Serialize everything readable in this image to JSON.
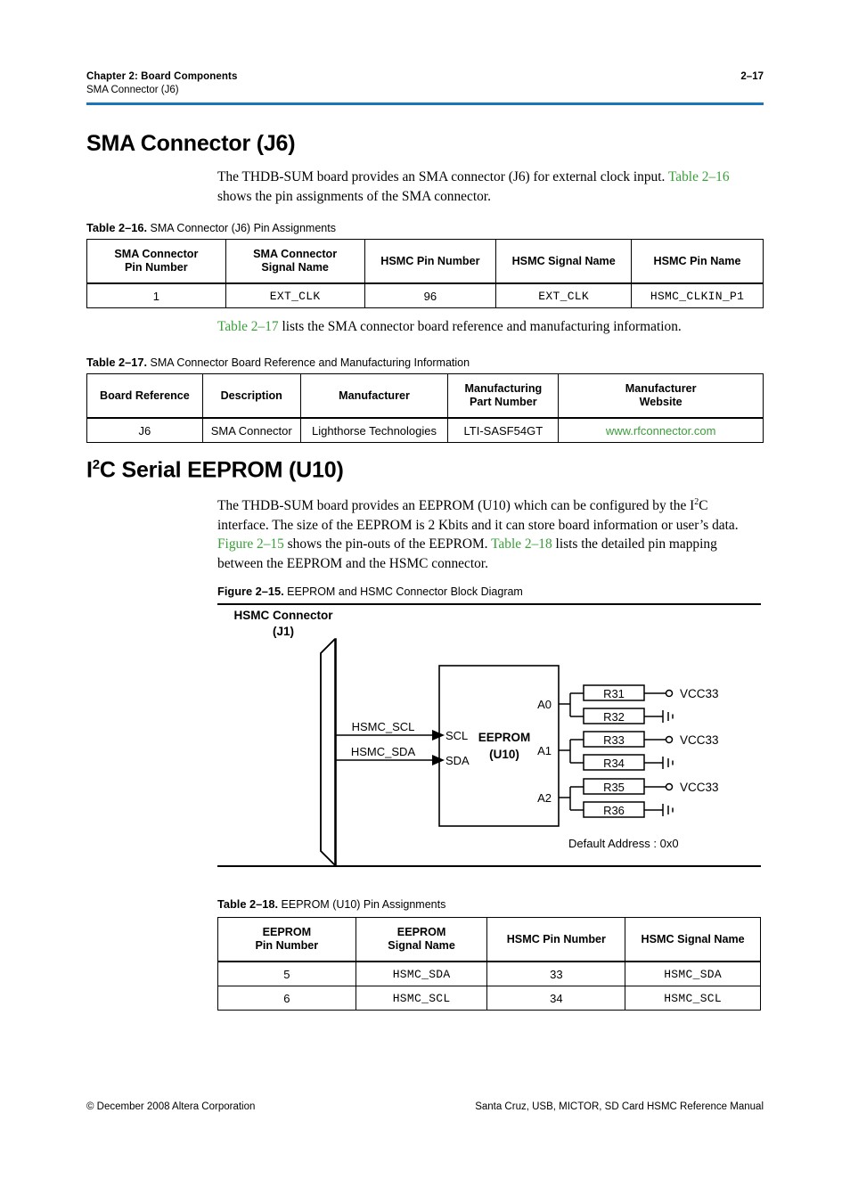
{
  "header": {
    "chapter": "Chapter 2:  Board Components",
    "subtitle": "SMA Connector (J6)",
    "page_number": "2–17",
    "rule_color": "#1b75bb"
  },
  "colors": {
    "link_green": "#3a9e3a",
    "rule_blue": "#1b75bb"
  },
  "sections": {
    "sma": {
      "heading": "SMA Connector (J6)",
      "para1_a": "The THDB-SUM board provides an SMA connector (J6) for external clock input. ",
      "para1_link": "Table 2–16",
      "para1_b": " shows the pin assignments of the SMA connector.",
      "para2_link": "Table 2–17",
      "para2_b": " lists the SMA connector board reference and manufacturing information."
    },
    "eeprom": {
      "heading_pre": "I",
      "heading_sup": "2",
      "heading_post": "C Serial EEPROM (U10)",
      "para_a": "The THDB-SUM board provides an EEPROM (U10) which can be configured by the I",
      "para_sup": "2",
      "para_b": "C interface. The size of the EEPROM is 2 Kbits and it can store board information or user’s data. ",
      "para_link1": "Figure 2–15",
      "para_c": " shows the pin-outs of the EEPROM. ",
      "para_link2": "Table 2–18",
      "para_d": " lists the detailed pin mapping between the EEPROM and the HSMC connector."
    }
  },
  "table_2_16": {
    "caption_label": "Table 2–16.",
    "caption_text": "SMA Connector (J6) Pin Assignments",
    "headers": [
      "SMA Connector\nPin Number",
      "SMA Connector\nSignal Name",
      "HSMC Pin Number",
      "HSMC Signal Name",
      "HSMC Pin Name"
    ],
    "header_lines": [
      [
        "SMA Connector",
        "Pin Number"
      ],
      [
        "SMA Connector",
        "Signal Name"
      ],
      [
        "HSMC Pin Number",
        ""
      ],
      [
        "HSMC Signal Name",
        ""
      ],
      [
        "HSMC Pin Name",
        ""
      ]
    ],
    "rows": [
      [
        "1",
        "EXT_CLK",
        "96",
        "EXT_CLK",
        "HSMC_CLKIN_P1"
      ]
    ]
  },
  "table_2_17": {
    "caption_label": "Table 2–17.",
    "caption_text": "SMA Connector Board Reference and Manufacturing Information",
    "header_lines": [
      [
        "Board Reference",
        ""
      ],
      [
        "Description",
        ""
      ],
      [
        "Manufacturer",
        ""
      ],
      [
        "Manufacturing",
        "Part Number"
      ],
      [
        "Manufacturer",
        "Website"
      ]
    ],
    "rows": [
      [
        "J6",
        "SMA Connector",
        "Lighthorse Technologies",
        "LTI-SASF54GT",
        "www.rfconnector.com"
      ]
    ],
    "website_is_link": true
  },
  "figure_2_15": {
    "caption_label": "Figure 2–15.",
    "caption_text": "EEPROM and HSMC Connector Block Diagram",
    "connector_label_line1": "HSMC Connector",
    "connector_label_line2": "(J1)",
    "chip_label_line1": "EEPROM",
    "chip_label_line2": "(U10)",
    "signals": [
      {
        "wire_label": "HSMC_SCL",
        "pin": "SCL"
      },
      {
        "wire_label": "HSMC_SDA",
        "pin": "SDA"
      }
    ],
    "address_pins": [
      {
        "name": "A0",
        "pullup_resistor": "R31",
        "pulldown_resistor": "R32",
        "supply": "VCC33"
      },
      {
        "name": "A1",
        "pullup_resistor": "R33",
        "pulldown_resistor": "R34",
        "supply": "VCC33"
      },
      {
        "name": "A2",
        "pullup_resistor": "R35",
        "pulldown_resistor": "R36",
        "supply": "VCC33"
      }
    ],
    "note": "Default Address : 0x0"
  },
  "table_2_18": {
    "caption_label": "Table 2–18.",
    "caption_text": "EEPROM (U10) Pin Assignments",
    "header_lines": [
      [
        "EEPROM",
        "Pin Number"
      ],
      [
        "EEPROM",
        "Signal Name"
      ],
      [
        "HSMC Pin Number",
        ""
      ],
      [
        "HSMC Signal Name",
        ""
      ]
    ],
    "rows": [
      [
        "5",
        "HSMC_SDA",
        "33",
        "HSMC_SDA"
      ],
      [
        "6",
        "HSMC_SCL",
        "34",
        "HSMC_SCL"
      ]
    ]
  },
  "footer": {
    "left": "© December 2008   Altera Corporation",
    "right": "Santa Cruz, USB, MICTOR, SD Card HSMC Reference Manual"
  }
}
